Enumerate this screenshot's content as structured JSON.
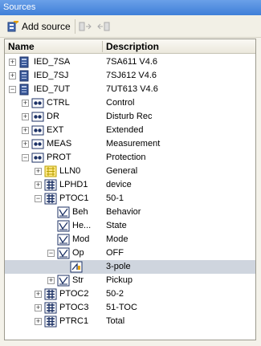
{
  "panel": {
    "title": "Sources"
  },
  "toolbar": {
    "add_label": "Add source"
  },
  "columns": {
    "name": "Name",
    "description": "Description"
  },
  "rows": [
    {
      "name": "IED_7SA",
      "desc": "7SA611 V4.6",
      "icon": "ied-icon",
      "exp": "+"
    },
    {
      "name": "IED_7SJ",
      "desc": "7SJ612 V4.6",
      "icon": "ied-icon",
      "exp": "+"
    },
    {
      "name": "IED_7UT",
      "desc": "7UT613 V4.6",
      "icon": "ied-icon",
      "exp": "−"
    },
    {
      "name": "CTRL",
      "desc": "Control",
      "icon": "logical-device-icon",
      "exp": "+"
    },
    {
      "name": "DR",
      "desc": "Disturb Rec",
      "icon": "logical-device-icon",
      "exp": "+"
    },
    {
      "name": "EXT",
      "desc": "Extended",
      "icon": "logical-device-icon",
      "exp": "+"
    },
    {
      "name": "MEAS",
      "desc": "Measurement",
      "icon": "logical-device-icon",
      "exp": "+"
    },
    {
      "name": "PROT",
      "desc": "Protection",
      "icon": "logical-device-icon",
      "exp": "−"
    },
    {
      "name": "LLN0",
      "desc": "General",
      "icon": "logical-node-zero-icon",
      "exp": "+"
    },
    {
      "name": "LPHD1",
      "desc": "device",
      "icon": "logical-node-icon",
      "exp": "+"
    },
    {
      "name": "PTOC1",
      "desc": "50-1",
      "icon": "logical-node-icon",
      "exp": "−"
    },
    {
      "name": "Beh",
      "desc": "Behavior",
      "icon": "data-object-icon",
      "exp": ""
    },
    {
      "name": "He...",
      "desc": "State",
      "icon": "data-object-icon",
      "exp": ""
    },
    {
      "name": "Mod",
      "desc": "Mode",
      "icon": "data-object-icon",
      "exp": ""
    },
    {
      "name": "Op",
      "desc": "OFF",
      "icon": "data-object-icon",
      "exp": "−"
    },
    {
      "name": "",
      "desc": "3-pole",
      "icon": "data-attribute-icon",
      "exp": ""
    },
    {
      "name": "Str",
      "desc": "Pickup",
      "icon": "data-object-icon",
      "exp": "+"
    },
    {
      "name": "PTOC2",
      "desc": "50-2",
      "icon": "logical-node-icon",
      "exp": "+"
    },
    {
      "name": "PTOC3",
      "desc": "51-TOC",
      "icon": "logical-node-icon",
      "exp": "+"
    },
    {
      "name": "PTRC1",
      "desc": "Total",
      "icon": "logical-node-icon",
      "exp": "+"
    }
  ]
}
